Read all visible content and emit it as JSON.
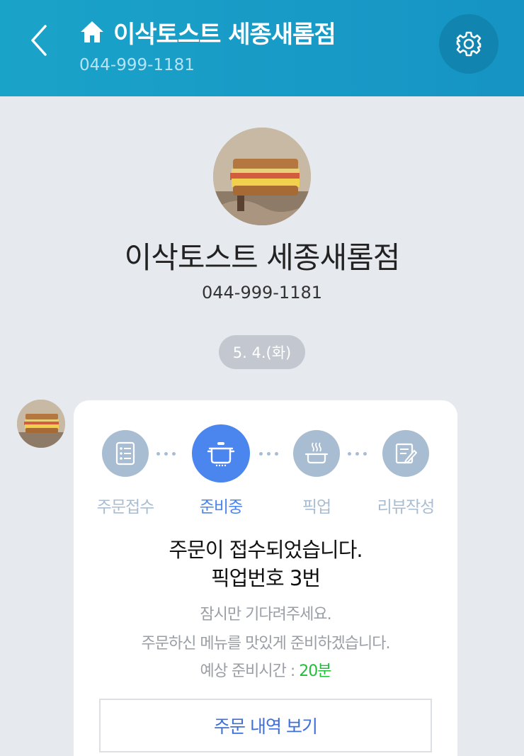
{
  "header": {
    "title": "이삭토스트 세종새롬점",
    "phone": "044-999-1181"
  },
  "store": {
    "name": "이삭토스트 세종새롬점",
    "phone": "044-999-1181"
  },
  "date": "5. 4.(화)",
  "order_status": {
    "steps": [
      {
        "label": "주문접수",
        "icon": "order-list-icon",
        "active": false
      },
      {
        "label": "준비중",
        "icon": "cooking-pot-icon",
        "active": true
      },
      {
        "label": "픽업",
        "icon": "food-bowl-icon",
        "active": false
      },
      {
        "label": "리뷰작성",
        "icon": "write-review-icon",
        "active": false
      }
    ],
    "message_line1": "주문이 접수되었습니다.",
    "message_line2": "픽업번호 3번",
    "sub_line1": "잠시만 기다려주세요.",
    "sub_line2": "주문하신 메뉴를 맛있게 준비하겠습니다.",
    "prep_label": "예상 준비시간 : ",
    "prep_time": "20분",
    "history_button": "주문 내역 보기"
  },
  "colors": {
    "header": "#1aa3c9",
    "active_step": "#4a86ee",
    "inactive_step": "#a9bdd2",
    "prep_time": "#1fbf3a"
  }
}
